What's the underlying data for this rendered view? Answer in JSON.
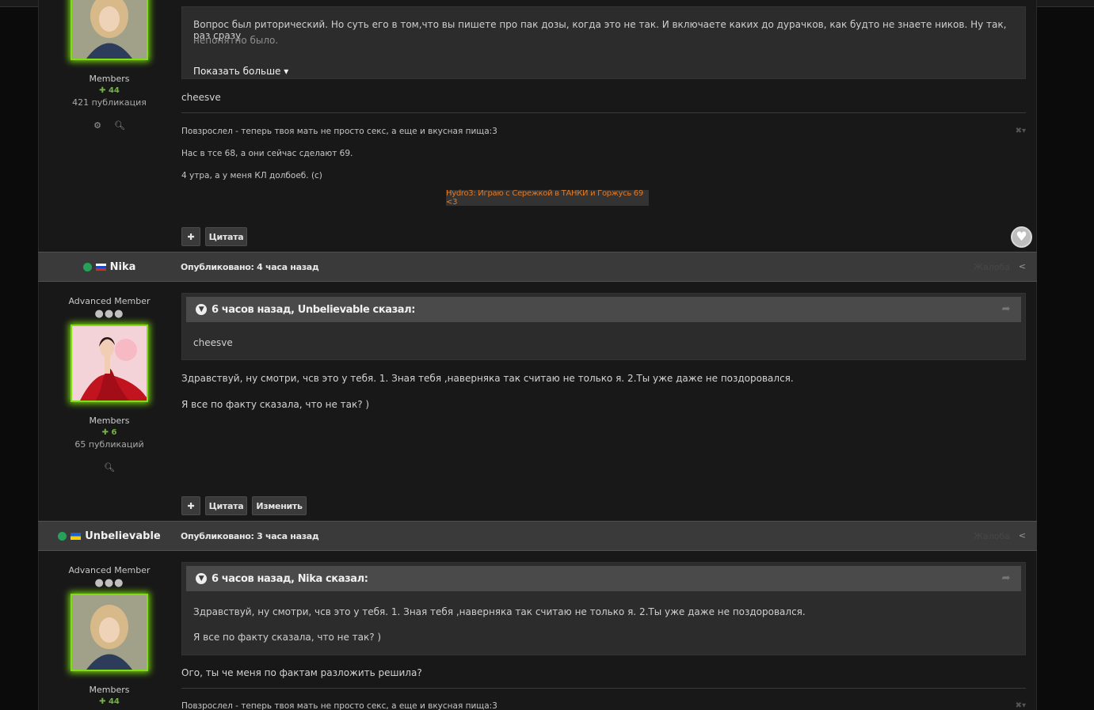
{
  "post1": {
    "author": {
      "group": "Members",
      "reputation": "44",
      "posts": "421 публикация"
    },
    "quote_text_line1": "Вопрос был риторический. Но суть его в том,что вы пишете про пак дозы, когда это не так. И включаете каких до дурачков, как будто не знаете ников. Ну так, раз сразу",
    "quote_text_line2": "непонятно было.",
    "show_more": "Показать больше",
    "body": "cheesve",
    "signature": {
      "line1": "Повзрослел - теперь твоя мать не просто секс, а еще и вкусная пища:3",
      "line2": "Нас в тсе 68, а они сейчас сделают 69.",
      "line3": "4 утра, а у меня КЛ долбоеб. (с)",
      "banner": "Hydro3: Играю с Сережкой в ТАНКИ и Горжусь 69 <3"
    },
    "buttons": {
      "plus": "✚",
      "quote": "Цитата"
    }
  },
  "post2": {
    "username": "Nika",
    "published": "Опубликовано: 4 часа назад",
    "report": "Жалоба",
    "author": {
      "rank": "Advanced Member",
      "group": "Members",
      "reputation": "6",
      "posts": "65 публикаций"
    },
    "quote_header": "6 часов назад, Unbelievable сказал:",
    "quote_text": "cheesve",
    "body_line1": "Здравствуй, ну смотри, чсв это у тебя. 1. Зная тебя ,наверняка так считаю не только я. 2.Ты уже даже не поздоровался.",
    "body_line2": "Я все по факту сказала, что не так? )",
    "buttons": {
      "plus": "✚",
      "quote": "Цитата",
      "edit": "Изменить"
    }
  },
  "post3": {
    "username": "Unbelievable",
    "published": "Опубликовано: 3 часа назад",
    "report": "Жалоба",
    "author": {
      "rank": "Advanced Member",
      "group": "Members",
      "reputation": "44"
    },
    "quote_header": "6 часов назад, Nika сказал:",
    "quote_text_line1": "Здравствуй, ну смотри, чсв это у тебя. 1. Зная тебя ,наверняка так считаю не только я. 2.Ты уже даже не поздоровался.",
    "quote_text_line2": "Я все по факту сказала, что не так? )",
    "body": "Ого, ты че меня по фактам разложить решила?",
    "signature_line1": "Повзрослел - теперь твоя мать не просто секс, а еще и вкусная пища:3"
  },
  "colors": {
    "online": "#27a05c",
    "avatar_border": "#7fdc16",
    "reputation": "#76b04a",
    "signature_banner": "#e07b2a"
  }
}
